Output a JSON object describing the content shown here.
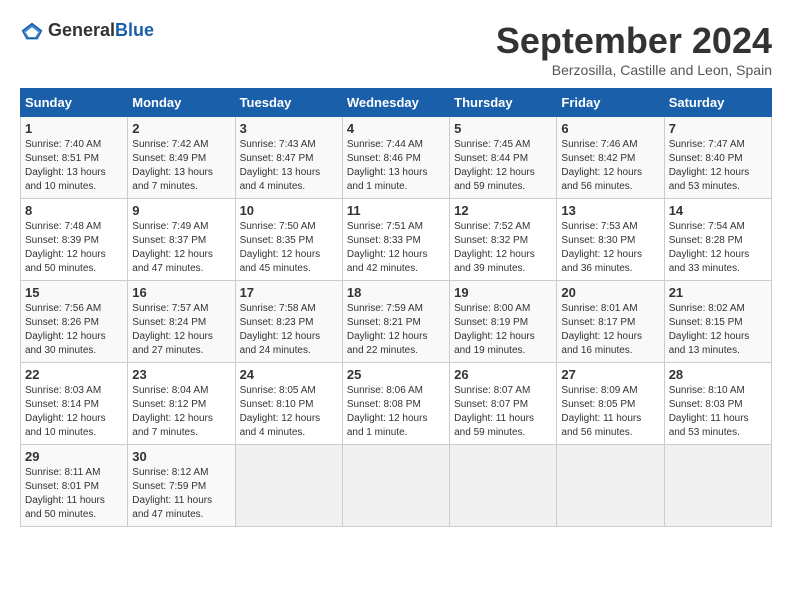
{
  "logo": {
    "general": "General",
    "blue": "Blue"
  },
  "header": {
    "month": "September 2024",
    "location": "Berzosilla, Castille and Leon, Spain"
  },
  "weekdays": [
    "Sunday",
    "Monday",
    "Tuesday",
    "Wednesday",
    "Thursday",
    "Friday",
    "Saturday"
  ],
  "weeks": [
    [
      {
        "day": "1",
        "sunrise": "7:40 AM",
        "sunset": "8:51 PM",
        "daylight": "13 hours and 10 minutes."
      },
      {
        "day": "2",
        "sunrise": "7:42 AM",
        "sunset": "8:49 PM",
        "daylight": "13 hours and 7 minutes."
      },
      {
        "day": "3",
        "sunrise": "7:43 AM",
        "sunset": "8:47 PM",
        "daylight": "13 hours and 4 minutes."
      },
      {
        "day": "4",
        "sunrise": "7:44 AM",
        "sunset": "8:46 PM",
        "daylight": "13 hours and 1 minute."
      },
      {
        "day": "5",
        "sunrise": "7:45 AM",
        "sunset": "8:44 PM",
        "daylight": "12 hours and 59 minutes."
      },
      {
        "day": "6",
        "sunrise": "7:46 AM",
        "sunset": "8:42 PM",
        "daylight": "12 hours and 56 minutes."
      },
      {
        "day": "7",
        "sunrise": "7:47 AM",
        "sunset": "8:40 PM",
        "daylight": "12 hours and 53 minutes."
      }
    ],
    [
      {
        "day": "8",
        "sunrise": "7:48 AM",
        "sunset": "8:39 PM",
        "daylight": "12 hours and 50 minutes."
      },
      {
        "day": "9",
        "sunrise": "7:49 AM",
        "sunset": "8:37 PM",
        "daylight": "12 hours and 47 minutes."
      },
      {
        "day": "10",
        "sunrise": "7:50 AM",
        "sunset": "8:35 PM",
        "daylight": "12 hours and 45 minutes."
      },
      {
        "day": "11",
        "sunrise": "7:51 AM",
        "sunset": "8:33 PM",
        "daylight": "12 hours and 42 minutes."
      },
      {
        "day": "12",
        "sunrise": "7:52 AM",
        "sunset": "8:32 PM",
        "daylight": "12 hours and 39 minutes."
      },
      {
        "day": "13",
        "sunrise": "7:53 AM",
        "sunset": "8:30 PM",
        "daylight": "12 hours and 36 minutes."
      },
      {
        "day": "14",
        "sunrise": "7:54 AM",
        "sunset": "8:28 PM",
        "daylight": "12 hours and 33 minutes."
      }
    ],
    [
      {
        "day": "15",
        "sunrise": "7:56 AM",
        "sunset": "8:26 PM",
        "daylight": "12 hours and 30 minutes."
      },
      {
        "day": "16",
        "sunrise": "7:57 AM",
        "sunset": "8:24 PM",
        "daylight": "12 hours and 27 minutes."
      },
      {
        "day": "17",
        "sunrise": "7:58 AM",
        "sunset": "8:23 PM",
        "daylight": "12 hours and 24 minutes."
      },
      {
        "day": "18",
        "sunrise": "7:59 AM",
        "sunset": "8:21 PM",
        "daylight": "12 hours and 22 minutes."
      },
      {
        "day": "19",
        "sunrise": "8:00 AM",
        "sunset": "8:19 PM",
        "daylight": "12 hours and 19 minutes."
      },
      {
        "day": "20",
        "sunrise": "8:01 AM",
        "sunset": "8:17 PM",
        "daylight": "12 hours and 16 minutes."
      },
      {
        "day": "21",
        "sunrise": "8:02 AM",
        "sunset": "8:15 PM",
        "daylight": "12 hours and 13 minutes."
      }
    ],
    [
      {
        "day": "22",
        "sunrise": "8:03 AM",
        "sunset": "8:14 PM",
        "daylight": "12 hours and 10 minutes."
      },
      {
        "day": "23",
        "sunrise": "8:04 AM",
        "sunset": "8:12 PM",
        "daylight": "12 hours and 7 minutes."
      },
      {
        "day": "24",
        "sunrise": "8:05 AM",
        "sunset": "8:10 PM",
        "daylight": "12 hours and 4 minutes."
      },
      {
        "day": "25",
        "sunrise": "8:06 AM",
        "sunset": "8:08 PM",
        "daylight": "12 hours and 1 minute."
      },
      {
        "day": "26",
        "sunrise": "8:07 AM",
        "sunset": "8:07 PM",
        "daylight": "11 hours and 59 minutes."
      },
      {
        "day": "27",
        "sunrise": "8:09 AM",
        "sunset": "8:05 PM",
        "daylight": "11 hours and 56 minutes."
      },
      {
        "day": "28",
        "sunrise": "8:10 AM",
        "sunset": "8:03 PM",
        "daylight": "11 hours and 53 minutes."
      }
    ],
    [
      {
        "day": "29",
        "sunrise": "8:11 AM",
        "sunset": "8:01 PM",
        "daylight": "11 hours and 50 minutes."
      },
      {
        "day": "30",
        "sunrise": "8:12 AM",
        "sunset": "7:59 PM",
        "daylight": "11 hours and 47 minutes."
      },
      null,
      null,
      null,
      null,
      null
    ]
  ]
}
